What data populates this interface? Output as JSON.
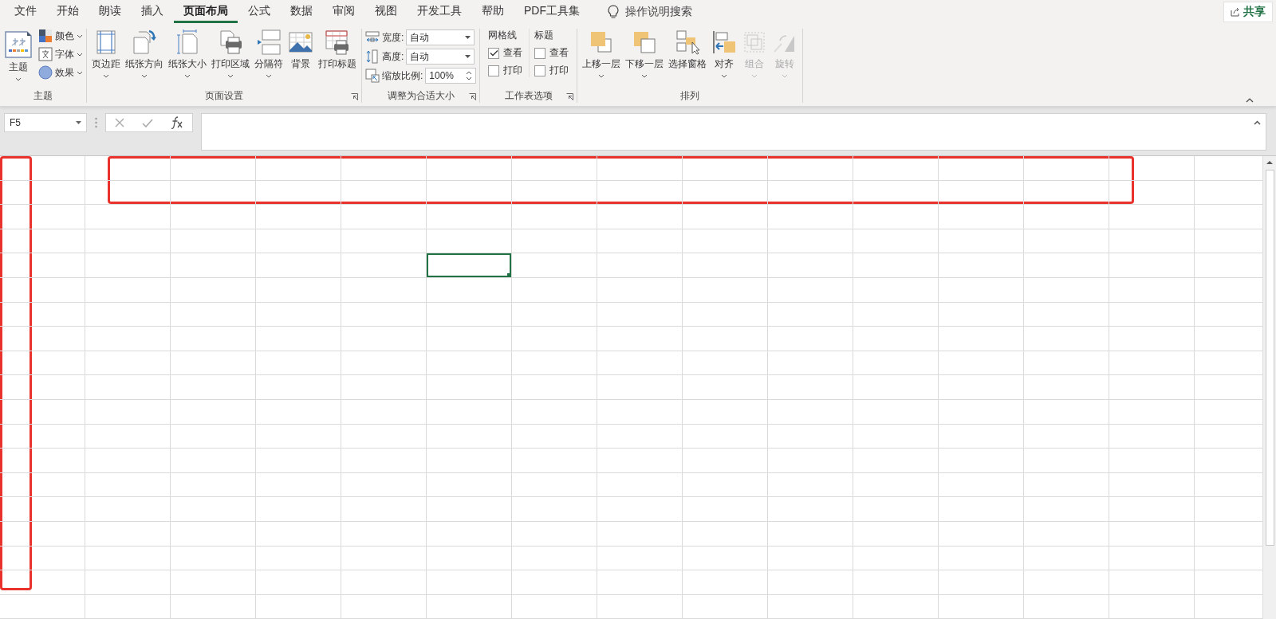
{
  "tabs": [
    {
      "label": "文件",
      "selected": false
    },
    {
      "label": "开始",
      "selected": false
    },
    {
      "label": "朗读",
      "selected": false
    },
    {
      "label": "插入",
      "selected": false
    },
    {
      "label": "页面布局",
      "selected": true
    },
    {
      "label": "公式",
      "selected": false
    },
    {
      "label": "数据",
      "selected": false
    },
    {
      "label": "审阅",
      "selected": false
    },
    {
      "label": "视图",
      "selected": false
    },
    {
      "label": "开发工具",
      "selected": false
    },
    {
      "label": "帮助",
      "selected": false
    },
    {
      "label": "PDF工具集",
      "selected": false
    }
  ],
  "tell_me": {
    "label": "操作说明搜索"
  },
  "share_button": {
    "label": "共享"
  },
  "ribbon_groups": [
    {
      "kind": "themes",
      "label": "主题",
      "launcher": false,
      "big_button": {
        "label": "主题",
        "dropdown": true
      },
      "small_buttons": [
        {
          "label": "颜色",
          "dropdown": true
        },
        {
          "label": "字体",
          "dropdown": true
        },
        {
          "label": "效果",
          "dropdown": true
        }
      ]
    },
    {
      "kind": "buttons",
      "label": "页面设置",
      "launcher": true,
      "buttons": [
        {
          "label": "页边距",
          "dropdown": true,
          "disabled": false
        },
        {
          "label": "纸张方向",
          "dropdown": true,
          "disabled": false
        },
        {
          "label": "纸张大小",
          "dropdown": true,
          "disabled": false
        },
        {
          "label": "打印区域",
          "dropdown": true,
          "disabled": false
        },
        {
          "label": "分隔符",
          "dropdown": true,
          "disabled": false
        },
        {
          "label": "背景",
          "dropdown": false,
          "disabled": false
        },
        {
          "label": "打印标题",
          "dropdown": false,
          "disabled": false
        }
      ]
    },
    {
      "kind": "scale",
      "label": "调整为合适大小",
      "launcher": true,
      "fields": [
        {
          "label": "宽度:",
          "value": "自动",
          "kind": "dropdown"
        },
        {
          "label": "高度:",
          "value": "自动",
          "kind": "dropdown"
        },
        {
          "label": "缩放比例:",
          "value": "100%",
          "kind": "spinner"
        }
      ]
    },
    {
      "kind": "sheet_options",
      "label": "工作表选项",
      "launcher": true,
      "columns": [
        {
          "title": "网格线",
          "options": [
            {
              "label": "查看",
              "checked": true
            },
            {
              "label": "打印",
              "checked": false
            }
          ]
        },
        {
          "title": "标题",
          "options": [
            {
              "label": "查看",
              "checked": false
            },
            {
              "label": "打印",
              "checked": false
            }
          ]
        }
      ]
    },
    {
      "kind": "buttons",
      "label": "排列",
      "launcher": false,
      "buttons": [
        {
          "label": "上移一层",
          "dropdown": true,
          "disabled": false
        },
        {
          "label": "下移一层",
          "dropdown": true,
          "disabled": false
        },
        {
          "label": "选择窗格",
          "dropdown": false,
          "disabled": false
        },
        {
          "label": "对齐",
          "dropdown": true,
          "disabled": false
        },
        {
          "label": "组合",
          "dropdown": true,
          "disabled": true
        },
        {
          "label": "旋转",
          "dropdown": true,
          "disabled": true
        }
      ]
    }
  ],
  "formula_bar": {
    "name_box": "F5"
  },
  "sheet": {
    "rows": [
      {
        "cells": [
          {
            "selected": false
          },
          {
            "selected": false
          },
          {
            "selected": false
          },
          {
            "selected": false
          },
          {
            "selected": false
          },
          {
            "selected": false
          },
          {
            "selected": false
          },
          {
            "selected": false
          },
          {
            "selected": false
          },
          {
            "selected": false
          },
          {
            "selected": false
          },
          {
            "selected": false
          },
          {
            "selected": false
          },
          {
            "selected": false
          },
          {
            "selected": false
          }
        ]
      },
      {
        "cells": [
          {
            "selected": false
          },
          {
            "selected": false
          },
          {
            "selected": false
          },
          {
            "selected": false
          },
          {
            "selected": false
          },
          {
            "selected": false
          },
          {
            "selected": false
          },
          {
            "selected": false
          },
          {
            "selected": false
          },
          {
            "selected": false
          },
          {
            "selected": false
          },
          {
            "selected": false
          },
          {
            "selected": false
          },
          {
            "selected": false
          },
          {
            "selected": false
          }
        ]
      },
      {
        "cells": [
          {
            "selected": false
          },
          {
            "selected": false
          },
          {
            "selected": false
          },
          {
            "selected": false
          },
          {
            "selected": false
          },
          {
            "selected": false
          },
          {
            "selected": false
          },
          {
            "selected": false
          },
          {
            "selected": false
          },
          {
            "selected": false
          },
          {
            "selected": false
          },
          {
            "selected": false
          },
          {
            "selected": false
          },
          {
            "selected": false
          },
          {
            "selected": false
          }
        ]
      },
      {
        "cells": [
          {
            "selected": false
          },
          {
            "selected": false
          },
          {
            "selected": false
          },
          {
            "selected": false
          },
          {
            "selected": false
          },
          {
            "selected": false
          },
          {
            "selected": false
          },
          {
            "selected": false
          },
          {
            "selected": false
          },
          {
            "selected": false
          },
          {
            "selected": false
          },
          {
            "selected": false
          },
          {
            "selected": false
          },
          {
            "selected": false
          },
          {
            "selected": false
          }
        ]
      },
      {
        "cells": [
          {
            "selected": false
          },
          {
            "selected": false
          },
          {
            "selected": false
          },
          {
            "selected": false
          },
          {
            "selected": false
          },
          {
            "selected": true
          },
          {
            "selected": false
          },
          {
            "selected": false
          },
          {
            "selected": false
          },
          {
            "selected": false
          },
          {
            "selected": false
          },
          {
            "selected": false
          },
          {
            "selected": false
          },
          {
            "selected": false
          },
          {
            "selected": false
          }
        ]
      },
      {
        "cells": [
          {
            "selected": false
          },
          {
            "selected": false
          },
          {
            "selected": false
          },
          {
            "selected": false
          },
          {
            "selected": false
          },
          {
            "selected": false
          },
          {
            "selected": false
          },
          {
            "selected": false
          },
          {
            "selected": false
          },
          {
            "selected": false
          },
          {
            "selected": false
          },
          {
            "selected": false
          },
          {
            "selected": false
          },
          {
            "selected": false
          },
          {
            "selected": false
          }
        ]
      },
      {
        "cells": [
          {
            "selected": false
          },
          {
            "selected": false
          },
          {
            "selected": false
          },
          {
            "selected": false
          },
          {
            "selected": false
          },
          {
            "selected": false
          },
          {
            "selected": false
          },
          {
            "selected": false
          },
          {
            "selected": false
          },
          {
            "selected": false
          },
          {
            "selected": false
          },
          {
            "selected": false
          },
          {
            "selected": false
          },
          {
            "selected": false
          },
          {
            "selected": false
          }
        ]
      },
      {
        "cells": [
          {
            "selected": false
          },
          {
            "selected": false
          },
          {
            "selected": false
          },
          {
            "selected": false
          },
          {
            "selected": false
          },
          {
            "selected": false
          },
          {
            "selected": false
          },
          {
            "selected": false
          },
          {
            "selected": false
          },
          {
            "selected": false
          },
          {
            "selected": false
          },
          {
            "selected": false
          },
          {
            "selected": false
          },
          {
            "selected": false
          },
          {
            "selected": false
          }
        ]
      },
      {
        "cells": [
          {
            "selected": false
          },
          {
            "selected": false
          },
          {
            "selected": false
          },
          {
            "selected": false
          },
          {
            "selected": false
          },
          {
            "selected": false
          },
          {
            "selected": false
          },
          {
            "selected": false
          },
          {
            "selected": false
          },
          {
            "selected": false
          },
          {
            "selected": false
          },
          {
            "selected": false
          },
          {
            "selected": false
          },
          {
            "selected": false
          },
          {
            "selected": false
          }
        ]
      },
      {
        "cells": [
          {
            "selected": false
          },
          {
            "selected": false
          },
          {
            "selected": false
          },
          {
            "selected": false
          },
          {
            "selected": false
          },
          {
            "selected": false
          },
          {
            "selected": false
          },
          {
            "selected": false
          },
          {
            "selected": false
          },
          {
            "selected": false
          },
          {
            "selected": false
          },
          {
            "selected": false
          },
          {
            "selected": false
          },
          {
            "selected": false
          },
          {
            "selected": false
          }
        ]
      },
      {
        "cells": [
          {
            "selected": false
          },
          {
            "selected": false
          },
          {
            "selected": false
          },
          {
            "selected": false
          },
          {
            "selected": false
          },
          {
            "selected": false
          },
          {
            "selected": false
          },
          {
            "selected": false
          },
          {
            "selected": false
          },
          {
            "selected": false
          },
          {
            "selected": false
          },
          {
            "selected": false
          },
          {
            "selected": false
          },
          {
            "selected": false
          },
          {
            "selected": false
          }
        ]
      },
      {
        "cells": [
          {
            "selected": false
          },
          {
            "selected": false
          },
          {
            "selected": false
          },
          {
            "selected": false
          },
          {
            "selected": false
          },
          {
            "selected": false
          },
          {
            "selected": false
          },
          {
            "selected": false
          },
          {
            "selected": false
          },
          {
            "selected": false
          },
          {
            "selected": false
          },
          {
            "selected": false
          },
          {
            "selected": false
          },
          {
            "selected": false
          },
          {
            "selected": false
          }
        ]
      },
      {
        "cells": [
          {
            "selected": false
          },
          {
            "selected": false
          },
          {
            "selected": false
          },
          {
            "selected": false
          },
          {
            "selected": false
          },
          {
            "selected": false
          },
          {
            "selected": false
          },
          {
            "selected": false
          },
          {
            "selected": false
          },
          {
            "selected": false
          },
          {
            "selected": false
          },
          {
            "selected": false
          },
          {
            "selected": false
          },
          {
            "selected": false
          },
          {
            "selected": false
          }
        ]
      },
      {
        "cells": [
          {
            "selected": false
          },
          {
            "selected": false
          },
          {
            "selected": false
          },
          {
            "selected": false
          },
          {
            "selected": false
          },
          {
            "selected": false
          },
          {
            "selected": false
          },
          {
            "selected": false
          },
          {
            "selected": false
          },
          {
            "selected": false
          },
          {
            "selected": false
          },
          {
            "selected": false
          },
          {
            "selected": false
          },
          {
            "selected": false
          },
          {
            "selected": false
          }
        ]
      },
      {
        "cells": [
          {
            "selected": false
          },
          {
            "selected": false
          },
          {
            "selected": false
          },
          {
            "selected": false
          },
          {
            "selected": false
          },
          {
            "selected": false
          },
          {
            "selected": false
          },
          {
            "selected": false
          },
          {
            "selected": false
          },
          {
            "selected": false
          },
          {
            "selected": false
          },
          {
            "selected": false
          },
          {
            "selected": false
          },
          {
            "selected": false
          },
          {
            "selected": false
          }
        ]
      },
      {
        "cells": [
          {
            "selected": false
          },
          {
            "selected": false
          },
          {
            "selected": false
          },
          {
            "selected": false
          },
          {
            "selected": false
          },
          {
            "selected": false
          },
          {
            "selected": false
          },
          {
            "selected": false
          },
          {
            "selected": false
          },
          {
            "selected": false
          },
          {
            "selected": false
          },
          {
            "selected": false
          },
          {
            "selected": false
          },
          {
            "selected": false
          },
          {
            "selected": false
          }
        ]
      },
      {
        "cells": [
          {
            "selected": false
          },
          {
            "selected": false
          },
          {
            "selected": false
          },
          {
            "selected": false
          },
          {
            "selected": false
          },
          {
            "selected": false
          },
          {
            "selected": false
          },
          {
            "selected": false
          },
          {
            "selected": false
          },
          {
            "selected": false
          },
          {
            "selected": false
          },
          {
            "selected": false
          },
          {
            "selected": false
          },
          {
            "selected": false
          },
          {
            "selected": false
          }
        ]
      },
      {
        "cells": [
          {
            "selected": false
          },
          {
            "selected": false
          },
          {
            "selected": false
          },
          {
            "selected": false
          },
          {
            "selected": false
          },
          {
            "selected": false
          },
          {
            "selected": false
          },
          {
            "selected": false
          },
          {
            "selected": false
          },
          {
            "selected": false
          },
          {
            "selected": false
          },
          {
            "selected": false
          },
          {
            "selected": false
          },
          {
            "selected": false
          },
          {
            "selected": false
          }
        ]
      },
      {
        "cells": [
          {
            "selected": false
          },
          {
            "selected": false
          },
          {
            "selected": false
          },
          {
            "selected": false
          },
          {
            "selected": false
          },
          {
            "selected": false
          },
          {
            "selected": false
          },
          {
            "selected": false
          },
          {
            "selected": false
          },
          {
            "selected": false
          },
          {
            "selected": false
          },
          {
            "selected": false
          },
          {
            "selected": false
          },
          {
            "selected": false
          },
          {
            "selected": false
          }
        ]
      }
    ]
  }
}
